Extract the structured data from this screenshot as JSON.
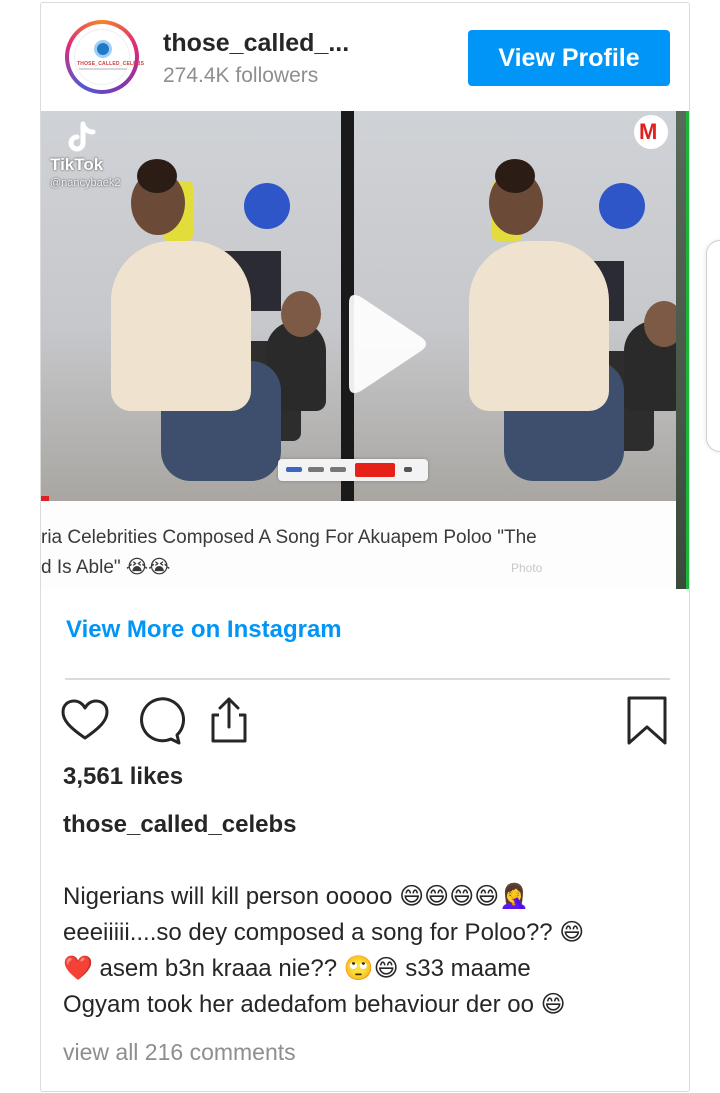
{
  "header": {
    "username": "those_called_...",
    "followers": "274.4K followers",
    "view_profile_label": "View Profile",
    "avatar_brand": "THOSE_CALLED_CELEBS"
  },
  "media": {
    "tiktok_label": "TikTok",
    "tiktok_handle": "@nancybaek2",
    "m_logo": "M",
    "caption_line1": "ria Celebrities Composed A Song For Akuapem Poloo \"The",
    "caption_line2": "d Is Able\" 😭😭",
    "watermark": "Photo"
  },
  "view_more_label": "View More on Instagram",
  "actions": [
    "heart-icon",
    "comment-icon",
    "share-icon",
    "bookmark-icon"
  ],
  "likes": "3,561 likes",
  "poster": "those_called_celebs",
  "post_caption": [
    "Nigerians will kill person ooooo 😄😄😄😄🤦‍♀️",
    "eeeiiiii....so dey composed a song for Poloo?? 😄",
    "❤️ asem b3n kraaa nie?? 🙄😄 s33 maame",
    "Ogyam took her adedafom behaviour der oo 😄"
  ],
  "view_comments": "view all 216 comments",
  "colors": {
    "accent": "#0095f6",
    "text": "#262626",
    "muted": "#8e8e8e",
    "border": "#dbdbdb"
  }
}
